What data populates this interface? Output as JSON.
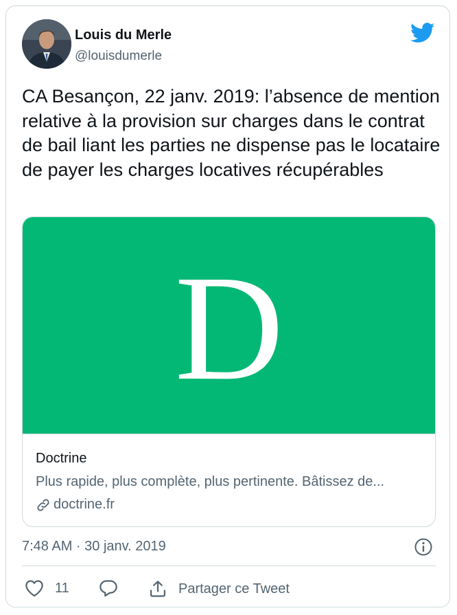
{
  "author": {
    "name": "Louis du Merle",
    "handle": "@louisdumerle"
  },
  "tweet": {
    "text": "CA Besançon, 22 janv. 2019: l’absence de mention relative à la provision sur charges dans le contrat de bail liant les parties ne dispense pas le locataire de payer les charges locatives récupérables",
    "timestamp": "7:48 AM · 30 janv. 2019"
  },
  "card": {
    "logo_letter": "D",
    "title": "Doctrine",
    "description": "Plus rapide, plus complète, plus pertinente. Bâtissez de...",
    "domain": "doctrine.fr",
    "image_color": "#03b875"
  },
  "actions": {
    "like_count": "11",
    "share_label": "Partager ce Tweet"
  },
  "icons": {
    "brand": "twitter-bird-icon",
    "info": "info-icon",
    "like": "heart-icon",
    "reply": "reply-icon",
    "share": "share-icon",
    "link": "link-icon"
  },
  "colors": {
    "accent": "#1d9bf0",
    "secondary_text": "#536471",
    "border": "#cfd9de"
  }
}
